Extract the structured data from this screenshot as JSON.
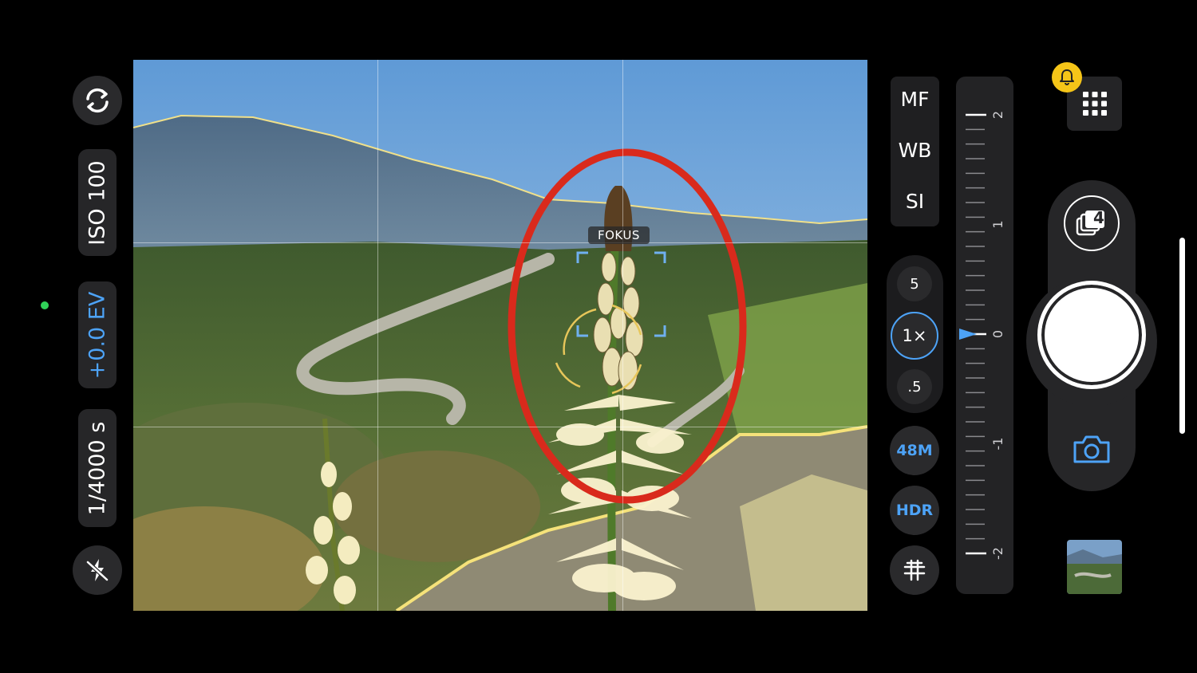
{
  "left_controls": {
    "switch_camera_icon": "rotate-camera-icon",
    "iso_label": "ISO 100",
    "ev_label": "+0.0 EV",
    "shutter_speed_label": "1/4000 s",
    "flash_icon": "flash-off-icon"
  },
  "viewfinder": {
    "focus_label": "FOKUS"
  },
  "modes": {
    "mf_label": "MF",
    "wb_label": "WB",
    "si_label": "SI"
  },
  "zoom": {
    "tele_label": "5",
    "wide_label": "1×",
    "ultrawide_label": ".5"
  },
  "options": {
    "resolution_label": "48M",
    "hdr_label": "HDR",
    "level_icon": "level-grid-icon"
  },
  "ev_slider": {
    "tick_labels": [
      "2",
      "1",
      "0",
      "-1",
      "-2"
    ],
    "current_value": 0
  },
  "right_controls": {
    "grid_menu_icon": "grid-menu-icon",
    "notification_icon": "bell-icon",
    "stack_count": "4",
    "mode_icon": "camera-icon",
    "thumbnail_icon": "last-photo-thumbnail"
  },
  "colors": {
    "accent_blue": "#4da3f7",
    "annotation_red": "#d92a1c",
    "bell_yellow": "#f5c518",
    "focus_peaking": "#f5e27a"
  }
}
